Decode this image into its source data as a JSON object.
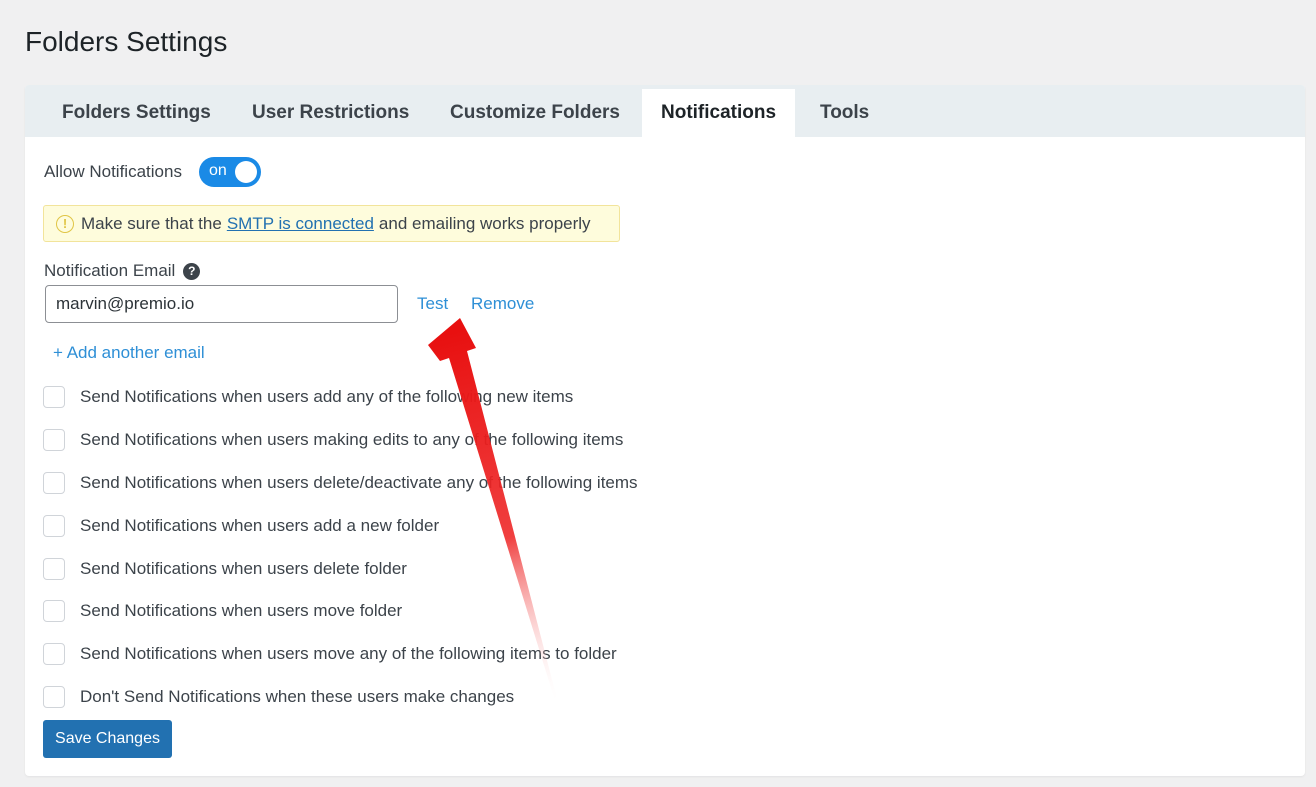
{
  "page": {
    "title": "Folders Settings"
  },
  "tabs": [
    {
      "label": "Folders Settings"
    },
    {
      "label": "User Restrictions"
    },
    {
      "label": "Customize Folders"
    },
    {
      "label": "Notifications",
      "active": true
    },
    {
      "label": "Tools"
    }
  ],
  "allow": {
    "label": "Allow Notifications",
    "toggle_text": "on",
    "toggle_state": true
  },
  "notice": {
    "icon": "info-circle-icon",
    "before": "Make sure that the",
    "link": "SMTP is connected",
    "after": "and emailing works properly"
  },
  "email": {
    "label": "Notification Email",
    "help_icon": "question-circle-icon",
    "value": "marvin@premio.io",
    "test_label": "Test",
    "remove_label": "Remove",
    "add_label": "+ Add another email"
  },
  "options": [
    "Send Notifications when users add any of the following new items",
    "Send Notifications when users making edits to any of the following items",
    "Send Notifications when users delete/deactivate any of the following items",
    "Send Notifications when users add a new folder",
    "Send Notifications when users delete folder",
    "Send Notifications when users move folder",
    "Send Notifications when users move any of the following items to folder",
    "Don't Send Notifications when these users make changes"
  ],
  "save_label": "Save Changes",
  "colors": {
    "accent": "#2271b1",
    "toggle": "#1a8ae6",
    "link": "#2e8fd6",
    "arrow": "#e81010"
  }
}
